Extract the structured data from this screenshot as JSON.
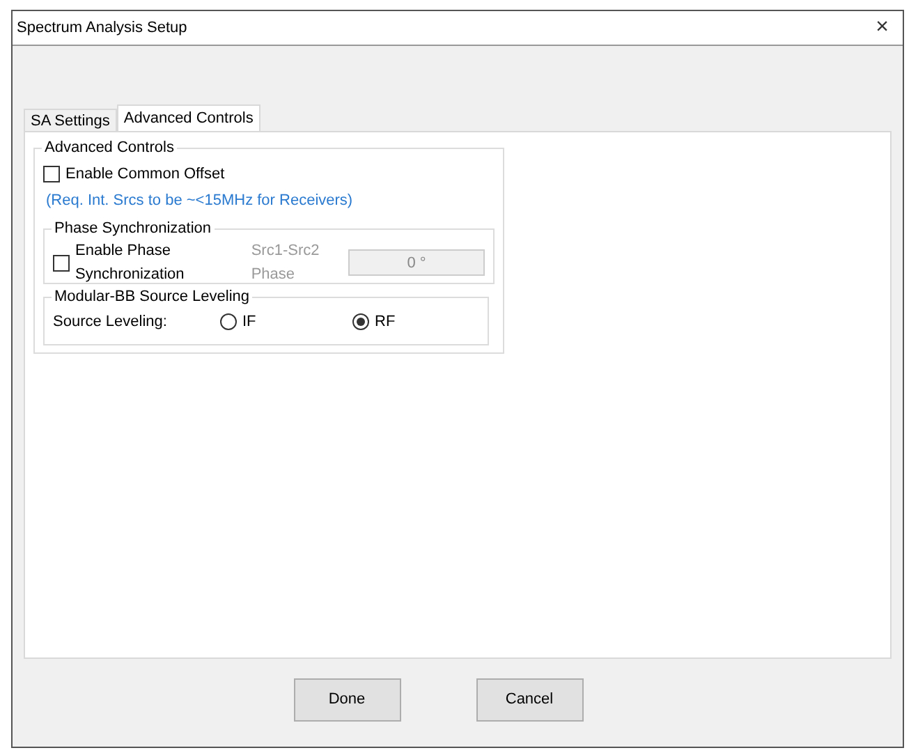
{
  "window": {
    "title": "Spectrum Analysis Setup",
    "close": "×"
  },
  "tabs": [
    {
      "label": "SA Settings",
      "selected": false
    },
    {
      "label": "Advanced Controls",
      "selected": true
    }
  ],
  "advanced_controls": {
    "title": "Advanced Controls",
    "common_offset": {
      "label": "Enable Common Offset",
      "checked": false
    },
    "note": "(Req. Int. Srcs to be ~<15MHz for Receivers)",
    "phase_sync": {
      "title": "Phase Synchronization",
      "checkbox": {
        "label": "Enable Phase Synchronization",
        "checked": false
      },
      "phase_label": "Src1-Src2 Phase",
      "phase_value": "0 °",
      "disabled": true
    },
    "source_leveling": {
      "title": "Modular-BB Source Leveling",
      "label": "Source Leveling:",
      "options": [
        {
          "label": "IF",
          "selected": false
        },
        {
          "label": "RF",
          "selected": true
        }
      ]
    }
  },
  "buttons": [
    "Done",
    "Cancel"
  ]
}
